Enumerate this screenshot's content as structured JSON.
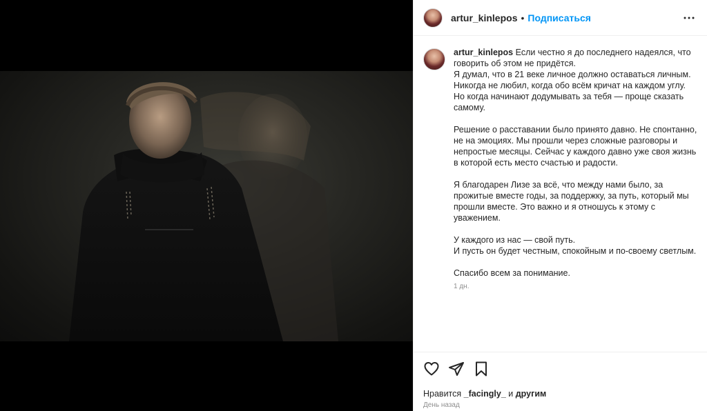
{
  "post": {
    "username": "artur_kinlepos",
    "separator": "•",
    "follow_label": "Подписаться"
  },
  "caption": {
    "username": "artur_kinlepos",
    "lines": [
      "Если честно я до последнего надеялся, что говорить об этом не придётся.",
      "Я думал, что в 21 веке личное должно оставаться личным.",
      "Никогда не любил, когда обо всём кричат на каждом углу.",
      "Но когда начинают додумывать за тебя — проще сказать самому.",
      "",
      "Решение о расставании было принято давно. Не спонтанно, не на эмоциях. Мы прошли через сложные разговоры и непростые месяцы. Сейчас у каждого давно уже своя жизнь в которой есть место счастью и радости.",
      "",
      "Я благодарен Лизе за всё, что между нами было, за прожитые вместе годы, за поддержку, за путь, который мы прошли вместе. Это важно и я отношусь к этому с уважением.",
      "",
      "У каждого из нас — свой путь.",
      "И пусть он будет честным, спокойным и по-своему светлым.",
      "",
      "Спасибо всем за понимание."
    ],
    "time": "1 дн."
  },
  "footer": {
    "likes_prefix": "Нравится",
    "likes_user": "_facingly_",
    "likes_middle": "и",
    "likes_others": "другим",
    "date": "День назад"
  },
  "icons": {
    "like": "heart-icon",
    "share": "paper-plane-icon",
    "save": "bookmark-icon",
    "more": "more-horizontal-icon"
  }
}
